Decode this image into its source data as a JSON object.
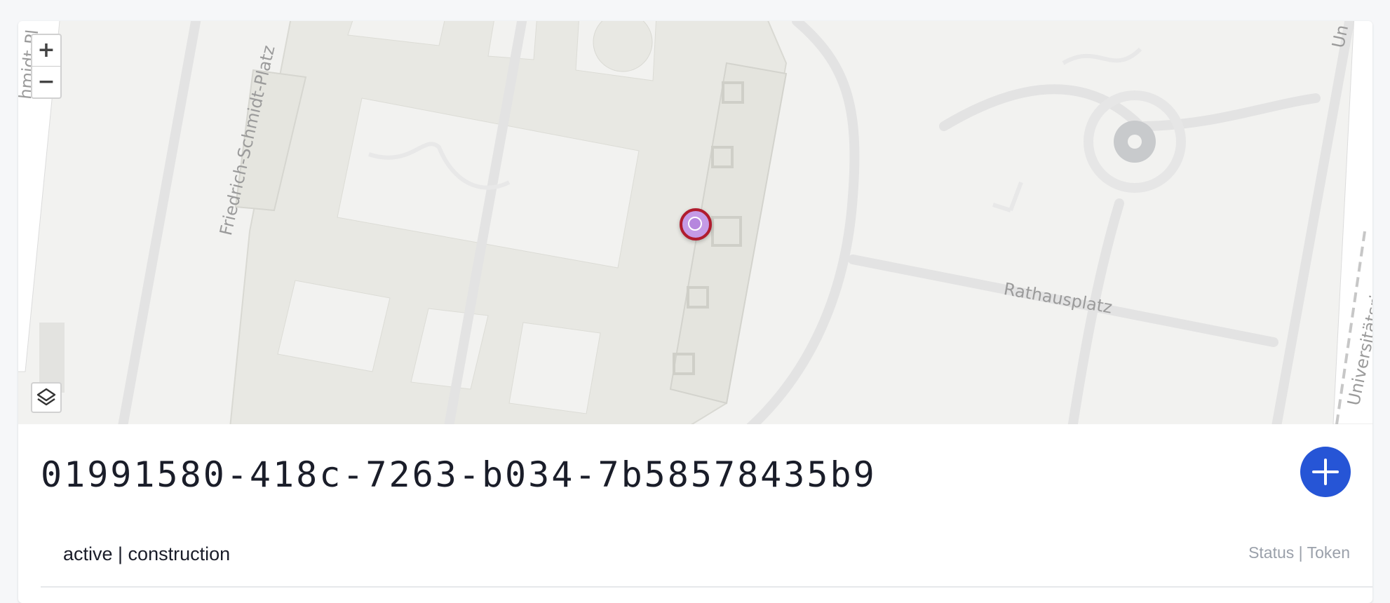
{
  "map": {
    "street_labels": {
      "friedrich": "Friedrich-Schmidt-Platz",
      "rathausplatz": "Rathausplatz",
      "universitaetsring": "Universitätsring",
      "edge_left": "hmidt-Pl",
      "edge_right": "Un"
    },
    "zoom_in": "+",
    "zoom_out": "−",
    "marker_color": "#c59be6",
    "marker_border_color": "#b01c2e"
  },
  "record": {
    "id": "01991580-418c-7263-b034-7b58578435b9",
    "status_value": "active | construction",
    "status_label": "Status | Token"
  },
  "colors": {
    "accent": "#2655d6"
  }
}
